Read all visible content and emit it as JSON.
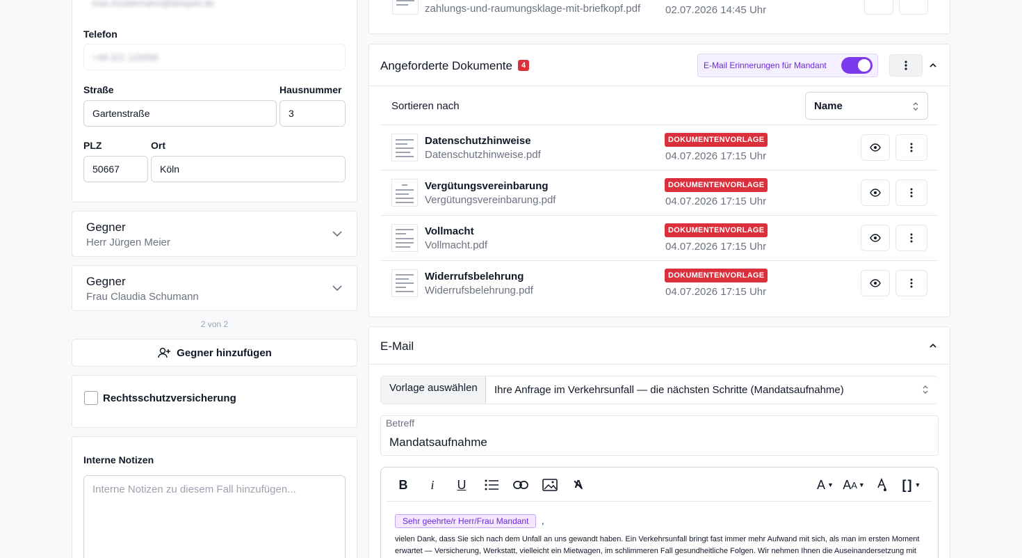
{
  "left": {
    "email_value": "max.mustermann@beispiel.de",
    "phone_label": "Telefon",
    "phone_value": "+49 221 123456",
    "street_label": "Straße",
    "street_value": "Gartenstraße",
    "house_label": "Hausnummer",
    "house_value": "3",
    "zip_label": "PLZ",
    "zip_value": "50667",
    "city_label": "Ort",
    "city_value": "Köln",
    "opponents": [
      {
        "title": "Gegner",
        "name": "Herr Jürgen Meier"
      },
      {
        "title": "Gegner",
        "name": "Frau Claudia Schumann"
      }
    ],
    "pagination": "2 von 2",
    "add_opponent": "Gegner hinzufügen",
    "insurance_label": "Rechtsschutzversicherung",
    "notes_label": "Interne Notizen",
    "notes_placeholder": "Interne Notizen zu diesem Fall hinzufügen..."
  },
  "top_doc": {
    "file": "zahlungs-und-raumungsklage-mit-briefkopf.pdf",
    "date": "02.07.2026 14:45 Uhr"
  },
  "requested": {
    "title": "Angeforderte Dokumente",
    "count": "4",
    "reminder_label": "E-Mail Erinnerungen für Mandant",
    "sort_label": "Sortieren nach",
    "sort_value": "Name",
    "docs": [
      {
        "title": "Datenschutzhinweise",
        "file": "Datenschutzhinweise.pdf",
        "tag": "DOKUMENTENVORLAGE",
        "date": "04.07.2026 17:15 Uhr"
      },
      {
        "title": "Vergütungsvereinbarung",
        "file": "Vergütungsvereinbarung.pdf",
        "tag": "DOKUMENTENVORLAGE",
        "date": "04.07.2026 17:15 Uhr"
      },
      {
        "title": "Vollmacht",
        "file": "Vollmacht.pdf",
        "tag": "DOKUMENTENVORLAGE",
        "date": "04.07.2026 17:15 Uhr"
      },
      {
        "title": "Widerrufsbelehrung",
        "file": "Widerrufsbelehrung.pdf",
        "tag": "DOKUMENTENVORLAGE",
        "date": "04.07.2026 17:15 Uhr"
      }
    ]
  },
  "email": {
    "title": "E-Mail",
    "template_label": "Vorlage auswählen",
    "template_value": "Ihre Anfrage im Verkehrsunfall — die nächsten Schritte (Mandatsaufnahme)",
    "subject_label": "Betreff",
    "subject_value": "Mandatsaufnahme",
    "placeholder_chip": "Sehr geehrte/r Herr/Frau Mandant",
    "chip_suffix": ",",
    "body_line1": "vielen Dank, dass Sie sich nach dem Unfall an uns gewandt haben. Ein Verkehrsunfall bringt fast immer mehr Aufwand mit sich, als man im ersten Moment",
    "body_line2": "erwartet — Versicherung, Werkstatt, vielleicht ein Mietwagen, im schlimmeren Fall gesundheitliche Folgen. Wir nehmen Ihnen die Auseinandersetzung mit"
  },
  "colors": {
    "accent": "#7c3aed",
    "badge": "#dc2f3c"
  }
}
